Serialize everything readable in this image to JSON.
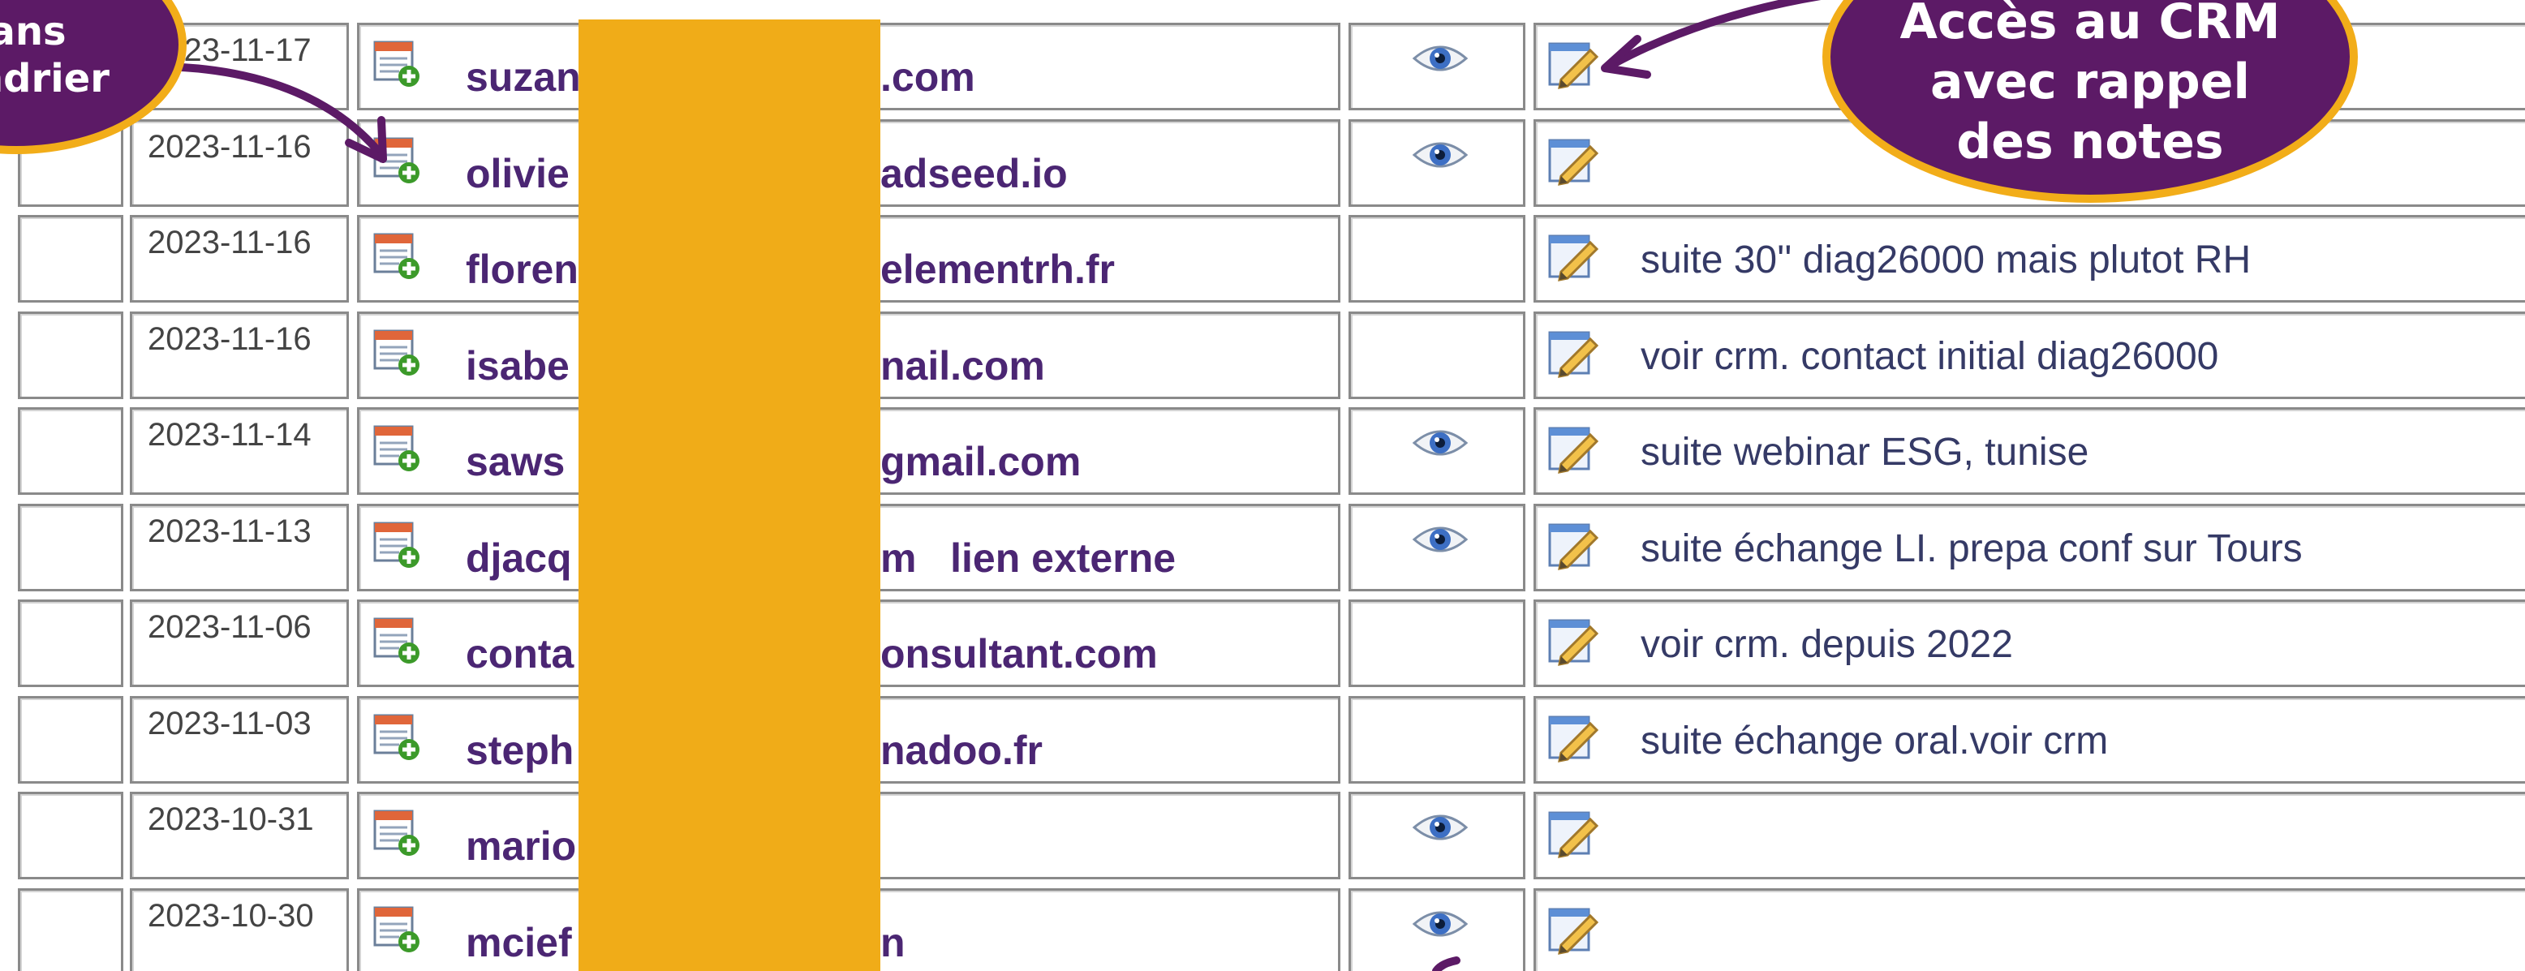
{
  "table": {
    "rows": [
      {
        "date": "2023-11-17",
        "email": "suzan",
        "email_suffix": ".com",
        "has_view": true,
        "note": ""
      },
      {
        "date": "2023-11-16",
        "email": "olivie",
        "email_suffix": "adseed.io",
        "has_view": true,
        "note": ""
      },
      {
        "date": "2023-11-16",
        "email": "floren",
        "email_suffix": "elementrh.fr",
        "has_view": false,
        "note": "suite 30'' diag26000 mais plutot RH"
      },
      {
        "date": "2023-11-16",
        "email": "isabe",
        "email_suffix": "nail.com",
        "has_view": false,
        "note": "voir crm. contact initial diag26000"
      },
      {
        "date": "2023-11-14",
        "email": "saws",
        "email_suffix": "gmail.com",
        "has_view": true,
        "note": "suite webinar ESG, tunise"
      },
      {
        "date": "2023-11-13",
        "email": "djacq",
        "email_suffix": "m   lien externe",
        "has_view": true,
        "note": "suite échange LI. prepa conf sur Tours"
      },
      {
        "date": "2023-11-06",
        "email": "conta",
        "email_suffix": "onsultant.com",
        "has_view": false,
        "note": "voir crm. depuis 2022"
      },
      {
        "date": "2023-11-03",
        "email": "steph",
        "email_suffix": "nadoo.fr",
        "has_view": false,
        "note": "suite échange oral.voir crm"
      },
      {
        "date": "2023-10-31",
        "email": "mario",
        "email_suffix": "",
        "has_view": true,
        "note": ""
      },
      {
        "date": "2023-10-30",
        "email": "mcief",
        "email_suffix": "n",
        "has_view": true,
        "note": ""
      }
    ]
  },
  "callouts": {
    "right": {
      "lines": [
        "Accès au CRM",
        "avec rappel",
        "des notes"
      ]
    },
    "left": {
      "lines": [
        "lans",
        "ndrier"
      ]
    }
  },
  "icons": {
    "calendar": "calendar-add-icon",
    "view": "eye-icon",
    "edit": "edit-note-icon"
  },
  "colors": {
    "redaction": "#f0ac18",
    "callout_fill": "#5c1a66",
    "callout_border": "#f2ad19",
    "email_text": "#4b2673",
    "note_text": "#353a66"
  }
}
